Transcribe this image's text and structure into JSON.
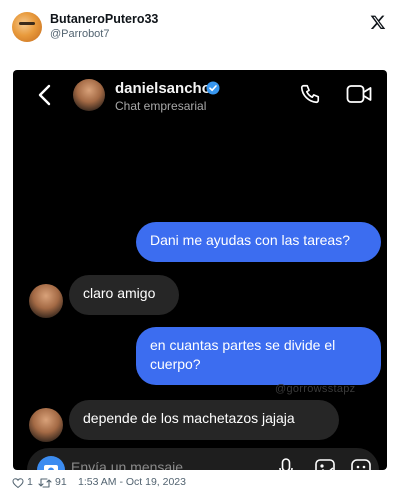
{
  "tweet": {
    "display_name": "ButaneroPutero33",
    "handle": "@Parrobot7",
    "logo_icon": "x-logo-icon",
    "likes": "1",
    "retweets": "91",
    "timestamp": "1:53 AM - Oct 19, 2023"
  },
  "dm": {
    "contact_name": "danielsancho",
    "subtitle": "Chat empresarial",
    "input_placeholder": "Envía un mensaje...",
    "watermark": "@gorrowsstapz",
    "messages": [
      {
        "from": "me",
        "text": "Dani me ayudas con las tareas?"
      },
      {
        "from": "them",
        "text": "claro amigo"
      },
      {
        "from": "me",
        "text": "en cuantas partes se divide el cuerpo?"
      },
      {
        "from": "them",
        "text": "depende de los machetazos jajaja"
      }
    ]
  },
  "colors": {
    "outgoing_bubble": "#3c6df0",
    "incoming_bubble": "#262626",
    "verified": "#3897f0"
  }
}
